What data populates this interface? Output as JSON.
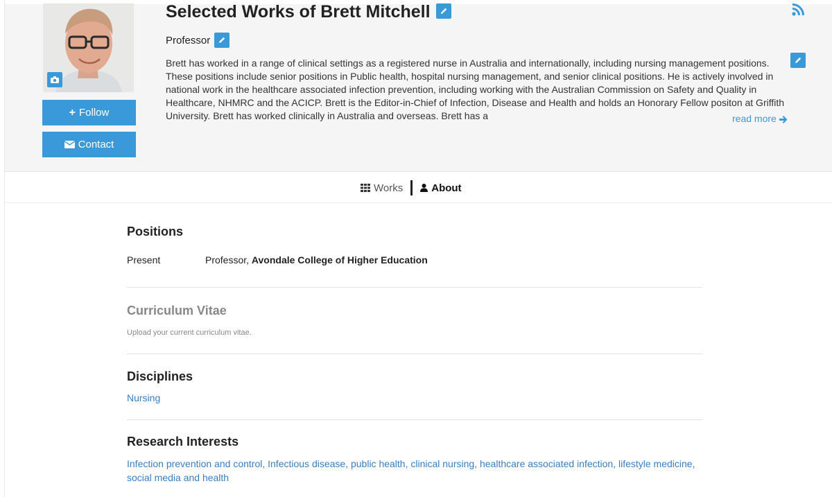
{
  "colors": {
    "accent": "#3a99d8",
    "link": "#3a7dc0",
    "header_bg": "#f5f5f5",
    "muted": "#888888"
  },
  "profile": {
    "name_title": "Selected Works of Brett Mitchell",
    "role": "Professor",
    "bio": "Brett has worked in a range of clinical settings as a registered nurse in Australia and internationally, including nursing management positions. These positions include senior positions in Public health, hospital nursing management, and senior clinical positions. He is actively involved in national work in the healthcare associated infection prevention, including working with the Australian Commission on Safety and Quality in Healthcare, NHMRC and the ACICP. Brett is the Editor-in-Chief of Infection, Disease and Health and holds an Honorary Fellow positon at Griffith University. Brett has worked clinically in Australia and overseas. Brett has a",
    "read_more": "read more"
  },
  "buttons": {
    "follow": "Follow",
    "contact": "Contact"
  },
  "icons": {
    "camera": "camera-icon",
    "edit": "pencil-icon",
    "rss": "rss-icon",
    "plus": "plus-icon",
    "envelope": "envelope-icon",
    "grid": "grid-icon",
    "user": "user-icon",
    "arrow": "arrow-right-icon"
  },
  "tabs": [
    {
      "label": "Works",
      "active": false
    },
    {
      "label": "About",
      "active": true
    }
  ],
  "positions": {
    "title": "Positions",
    "rows": [
      {
        "when": "Present",
        "role": "Professor",
        "separator": ", ",
        "institution": "Avondale College of Higher Education"
      }
    ]
  },
  "cv": {
    "title": "Curriculum Vitae",
    "hint": "Upload your current curriculum vitae."
  },
  "disciplines": {
    "title": "Disciplines",
    "items": [
      "Nursing"
    ]
  },
  "research": {
    "title": "Research Interests",
    "text": "Infection prevention and control, Infectious disease, public health, clinical nursing, healthcare associated infection, lifestyle medicine, social media and health"
  }
}
